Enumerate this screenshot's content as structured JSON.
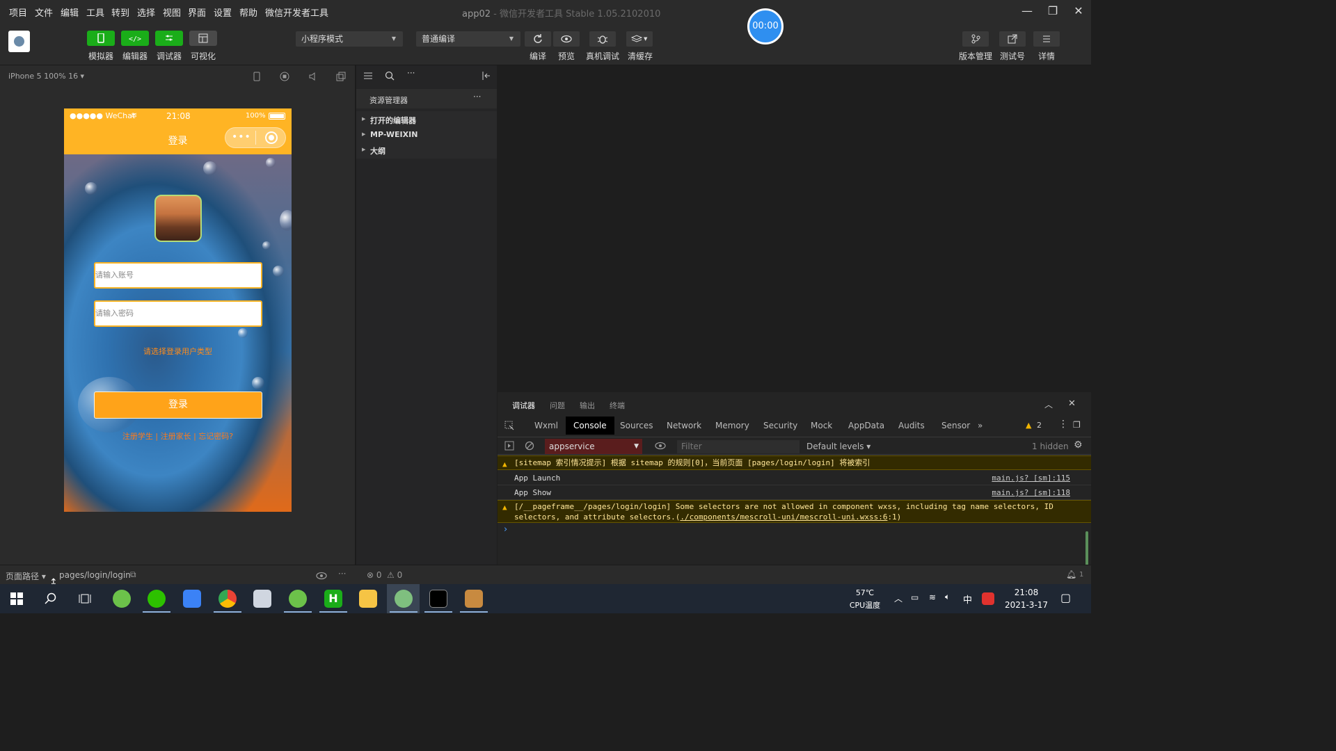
{
  "menu": [
    "项目",
    "文件",
    "编辑",
    "工具",
    "转到",
    "选择",
    "视图",
    "界面",
    "设置",
    "帮助",
    "微信开发者工具"
  ],
  "window_title": {
    "project": "app02",
    "rest": " - 微信开发者工具 Stable 1.05.2102010"
  },
  "toolbar": {
    "simulator": "模拟器",
    "editor": "编辑器",
    "debugger": "调试器",
    "visual": "可视化",
    "mode_select": "小程序模式",
    "compile_select": "普通编译",
    "compile": "编译",
    "preview": "预览",
    "real_debug": "真机调试",
    "clear_cache": "清缓存",
    "version": "版本管理",
    "test_id": "测试号",
    "details": "详情",
    "timer": "00:00"
  },
  "simulator": {
    "device": "iPhone 5 100% 16 ▾",
    "status_left": "●●●●● WeChat",
    "status_time": "21:08",
    "status_battery": "100%",
    "nav_title": "登录",
    "account_placeholder": "请输入账号",
    "password_placeholder": "请输入密码",
    "role_hint": "请选择登录用户类型",
    "login_button": "登录",
    "links": "注册学生 | 注册家长 | 忘记密码?"
  },
  "explorer": {
    "title": "资源管理器",
    "items": [
      "打开的编辑器",
      "MP-WEIXIN",
      "大纲"
    ]
  },
  "debugger": {
    "tabs": [
      "调试器",
      "问题",
      "输出",
      "终端"
    ],
    "devtabs": [
      "Wxml",
      "Console",
      "Sources",
      "Network",
      "Memory",
      "Security",
      "Mock",
      "AppData",
      "Audits",
      "Sensor",
      "»"
    ],
    "warn_count": "2",
    "context": "appservice",
    "filter_placeholder": "Filter",
    "levels": "Default levels ▾",
    "hidden": "1 hidden",
    "logs": [
      {
        "text": "[sitemap 索引情况提示] 根据 sitemap 的规则[0]，当前页面 [pages/login/login] 将被索引",
        "src": ""
      },
      {
        "text": "App Launch",
        "src": "main.js? [sm]:115"
      },
      {
        "text": "App Show",
        "src": "main.js? [sm]:118"
      },
      {
        "text": "[/__pageframe__/pages/login/login] Some selectors are not allowed in component wxss, including tag name selectors, ID",
        "text2": "selectors, and attribute selectors.(",
        "link": "./components/mescroll-uni/mescroll-uni.wxss:6",
        "tail": ":1)"
      }
    ],
    "prompt": "›"
  },
  "statusbar": {
    "page_path_label": "页面路径 ▾",
    "page_path": "pages/login/login",
    "errors": "⊗ 0",
    "warnings": "⚠ 0",
    "bell": "1"
  },
  "taskbar": {
    "temp": "57℃",
    "temp_label": "CPU温度",
    "ime": "中",
    "time": "21:08",
    "date": "2021-3-17"
  },
  "colors": {
    "wechat_green": "#1aad19",
    "phone_orange": "#ffb424",
    "timer_blue": "#2f8ff0"
  }
}
